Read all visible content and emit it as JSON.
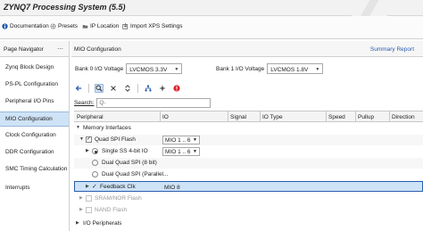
{
  "window": {
    "title": "ZYNQ7 Processing System (5.5)"
  },
  "toolbar": {
    "items": [
      {
        "label": "Documentation",
        "icon": "info-icon"
      },
      {
        "label": "Presets",
        "icon": "gear-icon"
      },
      {
        "label": "IP Location",
        "icon": "folder-icon"
      },
      {
        "label": "Import XPS Settings",
        "icon": "import-icon"
      }
    ]
  },
  "navigator": {
    "title": "Page Navigator",
    "items": [
      "Zynq Block Design",
      "PS-PL Configuration",
      "Peripheral I/O Pins",
      "MIO Configuration",
      "Clock Configuration",
      "DDR Configuration",
      "SMC Timing Calculation",
      "Interrupts"
    ],
    "selected": "MIO Configuration"
  },
  "main": {
    "title": "MIO Configuration",
    "summary_link": "Summary Report",
    "bank0": {
      "label": "Bank 0 I/O Voltage",
      "value": "LVCMOS 3.3V"
    },
    "bank1": {
      "label": "Bank 1 I/O Voltage",
      "value": "LVCMOS 1.8V"
    },
    "search": {
      "label": "Search:",
      "placeholder": "Q-"
    },
    "columns": [
      "Peripheral",
      "IO",
      "Signal",
      "IO Type",
      "Speed",
      "Pullup",
      "Direction"
    ],
    "rows": [
      {
        "label": "Memory Interfaces",
        "io": ""
      },
      {
        "label": "Quad SPI Flash",
        "io": "MIO 1 .. 6"
      },
      {
        "label": "Single SS 4-bit IO",
        "io": "MIO 1 .. 6"
      },
      {
        "label": "Dual Quad SPI (8 bit)",
        "io": ""
      },
      {
        "label": "Dual Quad SPI (Parallel...",
        "io": ""
      },
      {
        "label": "Feedback Clk",
        "io": "MIO 8"
      },
      {
        "label": "SRAM/NOR Flash",
        "io": ""
      },
      {
        "label": "NAND Flash",
        "io": ""
      },
      {
        "label": "I/O Peripherals",
        "io": ""
      }
    ]
  },
  "colors": {
    "accent": "#2a5db0",
    "selection": "#cfe3f7",
    "error": "#d9232a"
  }
}
